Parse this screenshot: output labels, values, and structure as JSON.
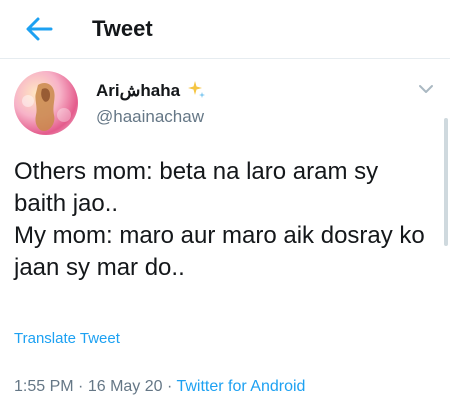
{
  "header": {
    "title": "Tweet",
    "back_icon": "arrow-left-icon",
    "accent": "#1da1f2"
  },
  "user": {
    "display_name": "Ariشhaha",
    "handle": "@haainachaw",
    "badge_icon": "sparkles-icon",
    "menu_icon": "chevron-down-icon"
  },
  "tweet": {
    "text": "Others mom: beta na laro aram sy baith jao..\nMy mom: maro aur maro aik dosray ko jaan sy mar do..",
    "translate_label": "Translate Tweet",
    "time": "1:55 PM",
    "separator": "·",
    "date": "16 May 20",
    "source": "Twitter for Android"
  },
  "colors": {
    "text": "#14171a",
    "secondary": "#657786",
    "link": "#1da1f2",
    "divider": "#e6ecf0"
  }
}
